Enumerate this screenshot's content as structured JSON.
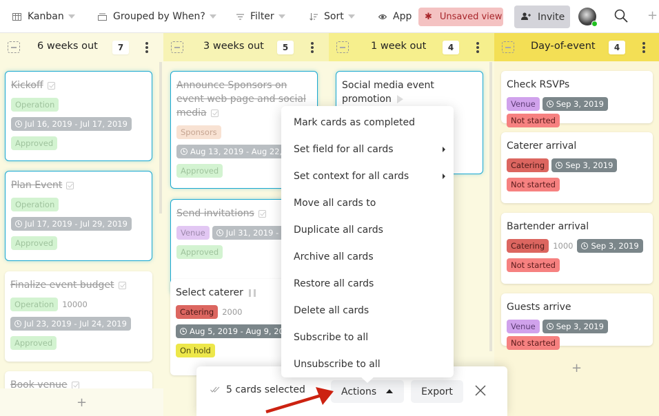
{
  "toolbar": {
    "view": {
      "label": "Kanban",
      "icon": "kanban-icon"
    },
    "group": {
      "label": "Grouped by When?",
      "icon": "group-icon"
    },
    "filter": {
      "label": "Filter",
      "icon": "filter-icon"
    },
    "sort": {
      "label": "Sort",
      "icon": "sort-icon"
    },
    "app": {
      "label": "App",
      "icon": "eye-icon"
    },
    "unsaved": {
      "label": "Unsaved view",
      "icon": "asterisk-icon"
    },
    "invite": {
      "label": "Invite",
      "icon": "add-user-icon"
    },
    "avatar_status": "online",
    "search_icon": "search-icon",
    "add_icon": "plus-icon"
  },
  "colors": {
    "selected_border": "#1aa8d0",
    "unsaved_bg": "#f4c2c2",
    "unsaved_text": "#a8262b",
    "online": "#20c020",
    "col_6weeks": "#fbf9e0",
    "col_3weeks": "#f7f3b4",
    "col_1week": "#f6ef8d",
    "col_day": "#f3df55",
    "tag_operation": "#b6ecb3",
    "tag_approved": "#b6ecb3",
    "tag_sponsors": "#f5cfb6",
    "tag_venue": "#d0a2ec",
    "tag_catering": "#dc6660",
    "tag_on_hold": "#ede74a",
    "tag_not_started": "#f68180",
    "date_gray": "#7b868a",
    "arrow": "#cc2211"
  },
  "columns": [
    {
      "title": "6 weeks out",
      "count": "7",
      "cards": [
        {
          "title": "Kickoff",
          "done": true,
          "selected": true,
          "rows": [
            [
              {
                "type": "tag",
                "text": "Operation",
                "kind": "operation"
              }
            ],
            [
              {
                "type": "date",
                "text": "Jul 16, 2019 - Jul 17, 2019"
              }
            ],
            [
              {
                "type": "tag",
                "text": "Approved",
                "kind": "approved"
              }
            ]
          ]
        },
        {
          "title": "Plan Event",
          "done": true,
          "selected": true,
          "rows": [
            [
              {
                "type": "tag",
                "text": "Operation",
                "kind": "operation"
              }
            ],
            [
              {
                "type": "date",
                "text": "Jul 17, 2019 - Jul 29, 2019"
              }
            ],
            [
              {
                "type": "tag",
                "text": "Approved",
                "kind": "approved"
              }
            ]
          ]
        },
        {
          "title": "Finalize event budget",
          "done": true,
          "selected": false,
          "rows": [
            [
              {
                "type": "tag",
                "text": "Operation",
                "kind": "operation"
              },
              {
                "type": "num",
                "text": "10000"
              }
            ],
            [
              {
                "type": "date",
                "text": "Jul 23, 2019 - Jul 24, 2019"
              }
            ],
            [
              {
                "type": "tag",
                "text": "Approved",
                "kind": "approved"
              }
            ]
          ]
        },
        {
          "title": "Book venue",
          "done": true,
          "selected": false,
          "rows": []
        }
      ]
    },
    {
      "title": "3 weeks out",
      "count": "5",
      "cards": [
        {
          "title": "Announce Sponsors on event web page and social media",
          "done": true,
          "selected": true,
          "rows": [
            [
              {
                "type": "tag",
                "text": "Sponsors",
                "kind": "sponsors"
              }
            ],
            [
              {
                "type": "date",
                "text": "Aug 13, 2019 - Aug 22, 2019"
              }
            ],
            [
              {
                "type": "tag",
                "text": "Approved",
                "kind": "approved"
              }
            ]
          ]
        },
        {
          "title": "Send invitations",
          "done": true,
          "selected": true,
          "rows": [
            [
              {
                "type": "tag",
                "text": "Venue",
                "kind": "venue"
              },
              {
                "type": "date",
                "text": "Jul 31, 2019 - Aug"
              }
            ],
            [
              {
                "type": "tag",
                "text": "Approved",
                "kind": "approved"
              }
            ]
          ]
        },
        {
          "title": "Select caterer",
          "done": false,
          "selected": false,
          "status_icon": "pause",
          "rows": [
            [
              {
                "type": "tag",
                "text": "Catering",
                "kind": "catering"
              },
              {
                "type": "num",
                "text": "2000"
              }
            ],
            [
              {
                "type": "date",
                "text": "Aug 5, 2019 - Aug 9, 2019"
              }
            ],
            [
              {
                "type": "tag",
                "text": "On hold",
                "kind": "on_hold"
              }
            ]
          ]
        }
      ]
    },
    {
      "title": "1 week out",
      "count": "4",
      "cards": [
        {
          "title": "Social media event promotion",
          "done": false,
          "selected": true,
          "status_icon": "play",
          "rows": []
        }
      ]
    },
    {
      "title": "Day-of-event",
      "count": "4",
      "cards": [
        {
          "title": "Check RSVPs",
          "done": false,
          "selected": false,
          "rows": [
            [
              {
                "type": "tag",
                "text": "Venue",
                "kind": "venue"
              },
              {
                "type": "date",
                "text": "Sep 3, 2019"
              },
              {
                "type": "tag",
                "text": "Not started",
                "kind": "not_started"
              }
            ]
          ]
        },
        {
          "title": "Caterer arrival",
          "done": false,
          "selected": false,
          "rows": [
            [
              {
                "type": "tag",
                "text": "Catering",
                "kind": "catering"
              },
              {
                "type": "date",
                "text": "Sep 3, 2019"
              }
            ],
            [
              {
                "type": "tag",
                "text": "Not started",
                "kind": "not_started"
              }
            ]
          ]
        },
        {
          "title": "Bartender arrival",
          "done": false,
          "selected": false,
          "rows": [
            [
              {
                "type": "tag",
                "text": "Catering",
                "kind": "catering"
              },
              {
                "type": "num",
                "text": "1000"
              },
              {
                "type": "date",
                "text": "Sep 3, 2019"
              }
            ],
            [
              {
                "type": "tag",
                "text": "Not started",
                "kind": "not_started"
              }
            ]
          ]
        },
        {
          "title": "Guests arrive",
          "done": false,
          "selected": false,
          "rows": [
            [
              {
                "type": "tag",
                "text": "Venue",
                "kind": "venue"
              },
              {
                "type": "date",
                "text": "Sep 3, 2019"
              },
              {
                "type": "tag",
                "text": "Not started",
                "kind": "not_started"
              }
            ]
          ]
        }
      ]
    }
  ],
  "add_card_label": "+",
  "menu": {
    "items": [
      {
        "label": "Mark cards as completed",
        "submenu": false
      },
      {
        "label": "Set field for all cards",
        "submenu": true
      },
      {
        "label": "Set context for all cards",
        "submenu": true
      },
      {
        "label": "Move all cards to",
        "submenu": false
      },
      {
        "label": "Duplicate all cards",
        "submenu": false
      },
      {
        "label": "Archive all cards",
        "submenu": false
      },
      {
        "label": "Restore all cards",
        "submenu": false
      },
      {
        "label": "Delete all cards",
        "submenu": false
      },
      {
        "label": "Subscribe to all",
        "submenu": false
      },
      {
        "label": "Unsubscribe to all",
        "submenu": false
      }
    ]
  },
  "selection_bar": {
    "count_label": "5 cards selected",
    "actions_label": "Actions",
    "export_label": "Export"
  }
}
